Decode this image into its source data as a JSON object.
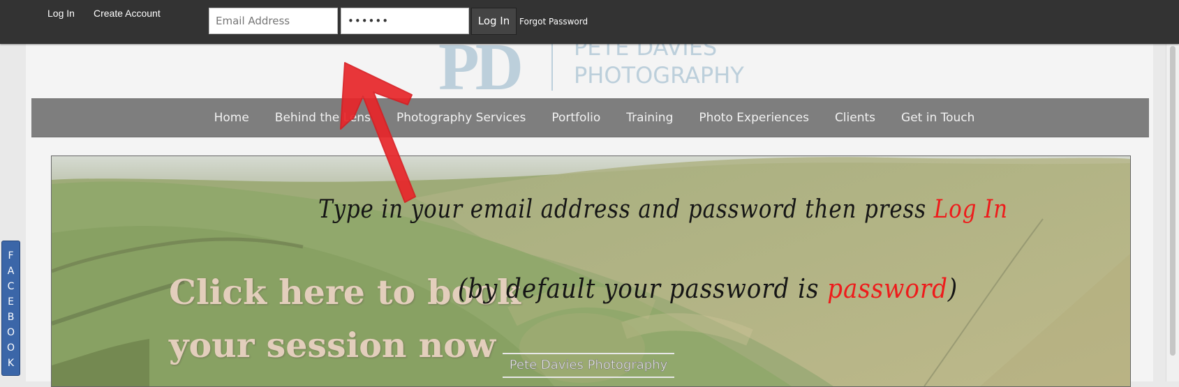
{
  "topbar": {
    "login_link": "Log In",
    "create_account_link": "Create Account",
    "email_placeholder": "Email Address",
    "password_value": "••••••",
    "login_button": "Log In",
    "forgot_password": "Forgot Password"
  },
  "logo": {
    "monogram": "PD",
    "name_line1": "PETE DAVIES",
    "name_line2": "PHOTOGRAPHY"
  },
  "nav": {
    "items": [
      "Home",
      "Behind the Lens",
      "Photography Services",
      "Portfolio",
      "Training",
      "Photo Experiences",
      "Clients",
      "Get in Touch"
    ]
  },
  "hero": {
    "cta_line1": "Click here to book",
    "cta_line2": "your session now",
    "watermark": "Pete Davies Photography"
  },
  "facebook_tab": {
    "letters": [
      "F",
      "A",
      "C",
      "E",
      "B",
      "O",
      "O",
      "K"
    ]
  },
  "annotation": {
    "line1_text": "Type in your email address and password then press",
    "line1_highlight": "Log In",
    "line2_open": "(by default your password is",
    "line2_highlight": "password",
    "line2_close": ")",
    "ink_color": "#151515",
    "highlight_color": "#ee1b1b"
  },
  "colors": {
    "topbar": "#333333",
    "nav": "#7e7e7e",
    "logo": "#bccfdb",
    "facebook": "#3b66a8",
    "arrow": "#e8262a"
  }
}
